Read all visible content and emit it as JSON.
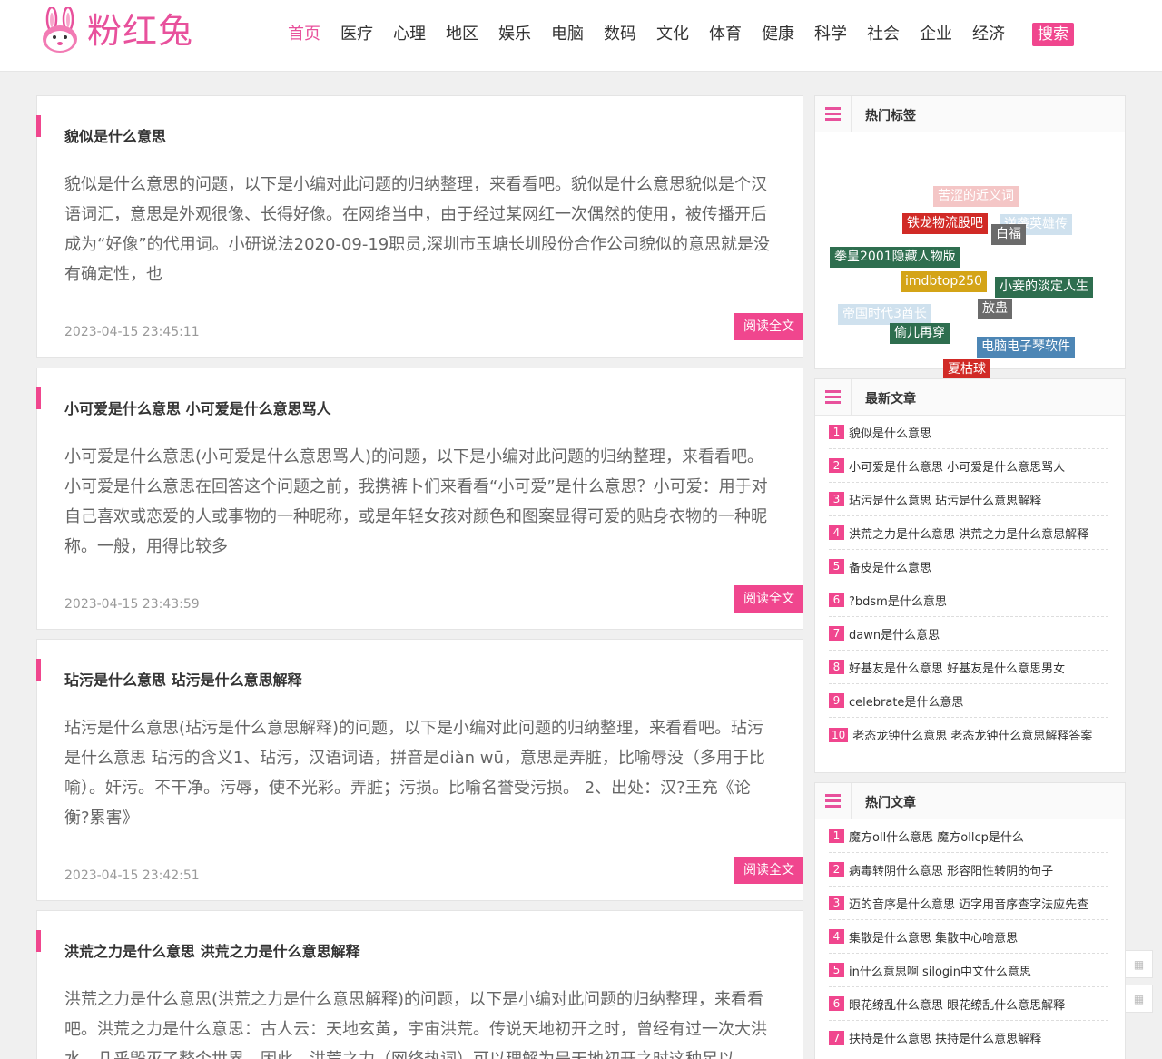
{
  "site": {
    "name": "粉红兔"
  },
  "nav": {
    "items": [
      "首页",
      "医疗",
      "心理",
      "地区",
      "娱乐",
      "电脑",
      "数码",
      "文化",
      "体育",
      "健康",
      "科学",
      "社会",
      "企业",
      "经济"
    ],
    "search_label": "搜索"
  },
  "articles": [
    {
      "title": "貌似是什么意思",
      "summary": "貌似是什么意思的问题，以下是小编对此问题的归纳整理，来看看吧。貌似是什么意思貌似是个汉语词汇，意思是外观很像、长得好像。在网络当中，由于经过某网红一次偶然的使用，被传播开后成为“好像”的代用词。小研说法2020-09-19职员,深圳市玉塘长圳股份合作公司貌似的意思就是没有确定性，也",
      "date": "2023-04-15 23:45:11",
      "read_more": "阅读全文"
    },
    {
      "title": "小可爱是什么意思 小可爱是什么意思骂人",
      "summary": "小可爱是什么意思(小可爱是什么意思骂人)的问题，以下是小编对此问题的归纳整理，来看看吧。小可爱是什么意思在回答这个问题之前，我携裤卜们来看看“小可爱”是什么意思？小可爱：用于对自己喜欢或恋爱的人或事物的一种昵称，或是年轻女孩对颜色和图案显得可爱的贴身衣物的一种昵称。一般，用得比较多",
      "date": "2023-04-15 23:43:59",
      "read_more": "阅读全文"
    },
    {
      "title": "玷污是什么意思 玷污是什么意思解释",
      "summary": "玷污是什么意思(玷污是什么意思解释)的问题，以下是小编对此问题的归纳整理，来看看吧。玷污是什么意思 玷污的含义1、玷污，汉语词语，拼音是diàn wū，意思是弄脏，比喻辱没（多用于比喻）。奸污。不干净。污辱，使不光彩。弄脏；污损。比喻名誉受污损。 2、出处：汉?王充《论衡?累害》",
      "date": "2023-04-15 23:42:51",
      "read_more": "阅读全文"
    },
    {
      "title": "洪荒之力是什么意思 洪荒之力是什么意思解释",
      "summary": "洪荒之力是什么意思(洪荒之力是什么意思解释)的问题，以下是小编对此问题的归纳整理，来看看吧。洪荒之力是什么意思：古人云：天地玄黄，宇宙洪荒。传说天地初开之时，曾经有过一次大洪水，几乎毁灭了整个世界。因此，洪荒之力（网络热词）可以理解为是天地初开之时这种足以",
      "date": "",
      "read_more": "阅读全文"
    }
  ],
  "hot_tags": {
    "title": "热门标签",
    "tags": [
      {
        "label": "苦涩的近义词",
        "color": "#f4c6c6"
      },
      {
        "label": "铁龙物流股吧",
        "color": "#d12a26"
      },
      {
        "label": "白福",
        "color": "#6b6b6b"
      },
      {
        "label": "逆袭英雄传",
        "color": "#cfe1ee"
      },
      {
        "label": "拳皇2001隐藏人物版",
        "color": "#2e6e4f"
      },
      {
        "label": "imdbtop250",
        "color": "#d4a417"
      },
      {
        "label": "小妾的淡定人生",
        "color": "#2e6e4f"
      },
      {
        "label": "放蛊",
        "color": "#6b6b6b"
      },
      {
        "label": "帝国时代3酋长",
        "color": "#cfe1ee"
      },
      {
        "label": "偷儿再穿",
        "color": "#2e6e4f"
      },
      {
        "label": "电脑电子琴软件",
        "color": "#4d86b5"
      },
      {
        "label": "夏枯球",
        "color": "#d12a26"
      }
    ]
  },
  "latest": {
    "title": "最新文章",
    "items": [
      "貌似是什么意思",
      "小可爱是什么意思 小可爱是什么意思骂人",
      "玷污是什么意思 玷污是什么意思解释",
      "洪荒之力是什么意思 洪荒之力是什么意思解释",
      "备皮是什么意思",
      "?bdsm是什么意思",
      "dawn是什么意思",
      "好基友是什么意思 好基友是什么意思男女",
      "celebrate是什么意思",
      "老态龙钟什么意思 老态龙钟什么意思解释答案"
    ]
  },
  "hot_articles": {
    "title": "热门文章",
    "items": [
      "魔方oll什么意思 魔方ollcp是什么",
      "病毒转阴什么意思 形容阳性转阴的句子",
      "迈的音序是什么意思 迈字用音序查字法应先查",
      "集散是什么意思 集散中心啥意思",
      "in什么意思啊 silogin中文什么意思",
      "眼花缭乱什么意思 眼花缭乱什么意思解释",
      "扶持是什么意思 扶持是什么意思解释"
    ]
  }
}
